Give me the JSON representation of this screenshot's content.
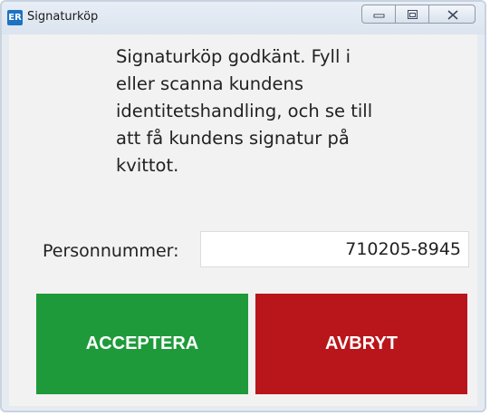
{
  "window": {
    "app_icon_text": "ER",
    "title": "Signaturköp",
    "controls": {
      "minimize_icon": "minimize-icon",
      "maximize_icon": "maximize-icon",
      "close_icon": "close-icon"
    }
  },
  "dialog": {
    "message": "Signaturköp godkänt. Fyll i eller scanna kundens identitetshandling, och se till att få kundens signatur på kvittot.",
    "personnummer_label": "Personnummer:",
    "personnummer_value": "710205-8945",
    "accept_label": "ACCEPTERA",
    "cancel_label": "AVBRYT"
  },
  "colors": {
    "accept": "#1e9a3a",
    "cancel": "#b9161b",
    "client_background": "#f2f2f2",
    "frame": "#e6ebf2"
  }
}
